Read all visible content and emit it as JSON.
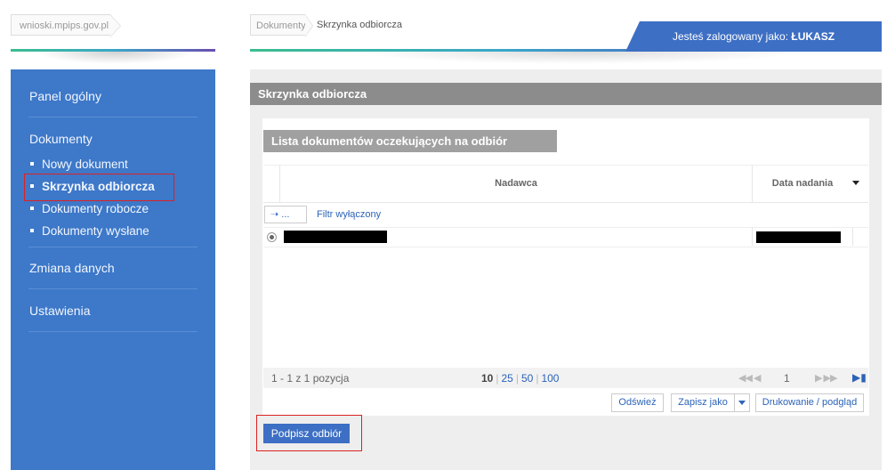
{
  "site": {
    "url_label": "wnioski.mpips.gov.pl"
  },
  "breadcrumb": {
    "root": "Dokumenty",
    "current": "Skrzynka odbiorcza"
  },
  "login": {
    "prefix": "Jesteś zalogowany jako:",
    "user": "ŁUKASZ"
  },
  "sidebar": {
    "items": [
      {
        "label": "Panel ogólny"
      },
      {
        "label": "Dokumenty"
      },
      {
        "label": "Zmiana danych"
      },
      {
        "label": "Ustawienia"
      }
    ],
    "sub_items": [
      {
        "label": "Nowy dokument"
      },
      {
        "label": "Skrzynka odbiorcza",
        "active": true
      },
      {
        "label": "Dokumenty robocze"
      },
      {
        "label": "Dokumenty wysłane"
      }
    ]
  },
  "main": {
    "title": "Skrzynka odbiorcza",
    "list_title": "Lista dokumentów oczekujących na odbiór",
    "columns": [
      "Nadawca",
      "Data nadania"
    ],
    "filter_button": "...",
    "filter_label": "Filtr wyłączony",
    "pager": {
      "info": "1 - 1 z 1 pozycja",
      "sizes": [
        "10",
        "25",
        "50",
        "100"
      ],
      "current_size": "10",
      "page": "1"
    },
    "toolbar": {
      "refresh": "Odśwież",
      "save_as": "Zapisz jako",
      "print": "Drukowanie / podgląd"
    },
    "sign_button": "Podpisz odbiór"
  },
  "colors": {
    "sidebar": "#3d78c9",
    "title_bar": "#8c8c8c",
    "accent": "#3d6fc4",
    "highlight": "#dd2222"
  }
}
